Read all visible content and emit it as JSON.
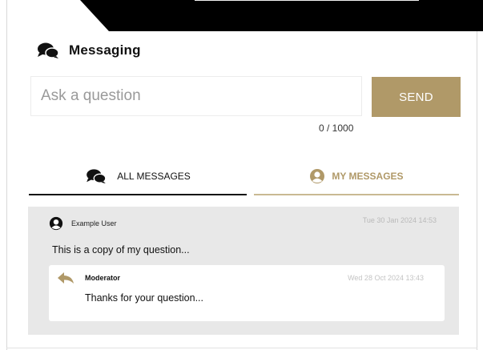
{
  "header": {
    "title": "Messaging"
  },
  "composer": {
    "placeholder": "Ask a question",
    "value": "",
    "send_label": "SEND",
    "counter": "0 / 1000"
  },
  "tabs": [
    {
      "label": "ALL MESSAGES",
      "active": false
    },
    {
      "label": "MY MESSAGES",
      "active": true
    }
  ],
  "thread": {
    "question": {
      "user": "Example User",
      "date": "Tue 30 Jan 2024 14:53",
      "text": "This is a copy of my question..."
    },
    "reply": {
      "user": "Moderator",
      "date": "Wed 28 Oct 2024 13:43",
      "text": "Thanks for your question..."
    }
  },
  "colors": {
    "accent": "#b09968",
    "accent_light": "#c9b993",
    "thread_bg": "#e8e8e8",
    "banner": "#000000"
  },
  "icons": {
    "title": "chat-bubbles-icon",
    "tab_all": "chat-bubbles-icon",
    "tab_mine": "user-circle-icon",
    "question_user": "user-circle-icon",
    "reply": "reply-arrow-icon"
  }
}
